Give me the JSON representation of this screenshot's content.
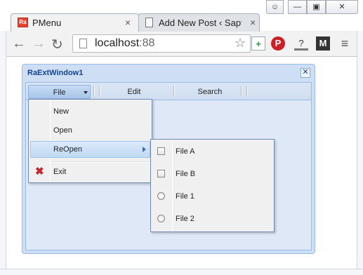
{
  "browser": {
    "tabs": [
      {
        "title": "PMenu",
        "favicon_text": "Ra",
        "close": "×"
      },
      {
        "title": "Add New Post ‹ Saptajit",
        "close": "×"
      }
    ],
    "window_buttons": [
      "□",
      "–",
      "▭",
      "✕"
    ],
    "nav": {
      "back": "←",
      "forward": "→",
      "reload": "↻"
    },
    "address": {
      "host": "localhost",
      "port": ":88"
    },
    "star": "☆",
    "extensions": [
      "+",
      "P",
      "?",
      "M",
      "≡"
    ]
  },
  "ext_window": {
    "title": "RaExtWindow1",
    "close": "✕",
    "toolbar": {
      "file_label": "File",
      "edit_label": "Edit",
      "search_label": "Search"
    },
    "file_menu": {
      "items": [
        {
          "label": "New"
        },
        {
          "label": "Open"
        },
        {
          "label": "ReOpen",
          "has_submenu": true,
          "active": true
        },
        {
          "label": "Exit",
          "icon": "red-x-icon"
        }
      ]
    },
    "reopen_submenu": {
      "items": [
        {
          "label": "File A",
          "control": "checkbox"
        },
        {
          "label": "File B",
          "control": "checkbox"
        },
        {
          "label": "File 1",
          "control": "radio"
        },
        {
          "label": "File 2",
          "control": "radio"
        }
      ]
    }
  },
  "colors": {
    "window_bg": "#cedff5",
    "window_border": "#99bbe8",
    "title_text": "#15428b",
    "accent_highlight": "#c1d9f5",
    "exit_icon": "#c0282d"
  }
}
